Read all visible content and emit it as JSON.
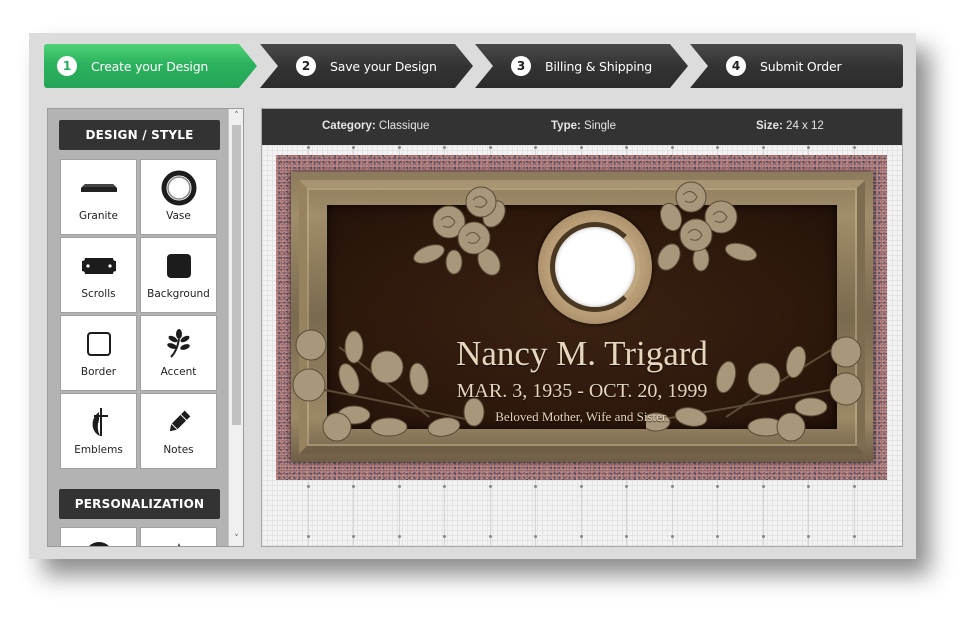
{
  "colors": {
    "active_step": "#2cb25e",
    "dark_step": "#333333",
    "panel_bg": "#dcdcdc",
    "section_header": "#333333",
    "bronze_text": "#e5d6bc"
  },
  "steps": [
    {
      "number": "1",
      "label": "Create your Design",
      "active": true
    },
    {
      "number": "2",
      "label": "Save your Design",
      "active": false
    },
    {
      "number": "3",
      "label": "Billing & Shipping",
      "active": false
    },
    {
      "number": "4",
      "label": "Submit Order",
      "active": false
    }
  ],
  "sidebar": {
    "sections": [
      {
        "title": "DESIGN / STYLE",
        "items": [
          {
            "label": "Granite",
            "icon": "granite-slab-icon"
          },
          {
            "label": "Vase",
            "icon": "vase-ring-icon"
          },
          {
            "label": "Scrolls",
            "icon": "scroll-plate-icon"
          },
          {
            "label": "Background",
            "icon": "background-square-icon"
          },
          {
            "label": "Border",
            "icon": "border-square-icon"
          },
          {
            "label": "Accent",
            "icon": "leaf-branch-icon"
          },
          {
            "label": "Emblems",
            "icon": "cross-flame-emblem-icon"
          },
          {
            "label": "Notes",
            "icon": "pencil-icon"
          }
        ]
      },
      {
        "title": "PERSONALIZATION",
        "items": [
          {
            "label": "",
            "icon": "circle-icon"
          },
          {
            "label": "",
            "icon": "triangle-icon"
          }
        ]
      }
    ],
    "scroll_up": "˄",
    "scroll_down": "˅"
  },
  "infobar": {
    "category_label": "Category:",
    "category_value": "Classique",
    "type_label": "Type:",
    "type_value": "Single",
    "size_label": "Size:",
    "size_value": "24 x 12"
  },
  "plaque": {
    "name": "Nancy M. Trigard",
    "dates": "MAR. 3, 1935 - OCT. 20, 1999",
    "epitaph": "Beloved Mother, Wife and Sister.",
    "granite": "Mahogany-pink granite",
    "background": "Dark leather bronze",
    "accents": [
      "rose-cluster-top-left",
      "rose-cluster-top-right",
      "rose-spray-bottom-left",
      "rose-spray-bottom-right"
    ],
    "vase": "Round vase ring"
  }
}
